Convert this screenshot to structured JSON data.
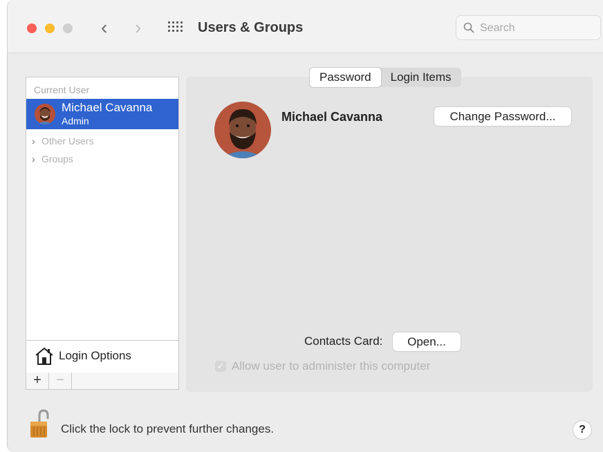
{
  "window": {
    "title": "Users & Groups",
    "search_placeholder": "Search"
  },
  "icons": {
    "close": "close-button",
    "minimize": "minimize-button",
    "zoom": "zoom-button",
    "back": "chevron-left-icon",
    "forward": "chevron-right-icon",
    "show_all": "grid-icon",
    "search": "search-icon",
    "login_options": "house-icon",
    "lock": "lock-icon",
    "help": "help-icon"
  },
  "sidebar": {
    "current_user_header": "Current User",
    "current_user": {
      "name": "Michael Cavanna",
      "role": "Admin"
    },
    "other_users_label": "Other Users",
    "groups_label": "Groups",
    "login_options_label": "Login Options",
    "add_label": "+",
    "remove_label": "−"
  },
  "tabs": [
    {
      "label": "Password",
      "active": true
    },
    {
      "label": "Login Items",
      "active": false
    }
  ],
  "main": {
    "user_name": "Michael Cavanna",
    "change_password_label": "Change Password...",
    "contacts_card_label": "Contacts Card:",
    "open_label": "Open...",
    "admin_checkbox_label": "Allow user to administer this computer",
    "admin_checked": true
  },
  "footer": {
    "lock_text": "Click the lock to prevent further changes.",
    "help_label": "?"
  },
  "colors": {
    "selection": "#2f63cf",
    "close": "#fc5f57",
    "minimize": "#fdbc2e",
    "zoom_disabled": "#cfcfcf"
  }
}
